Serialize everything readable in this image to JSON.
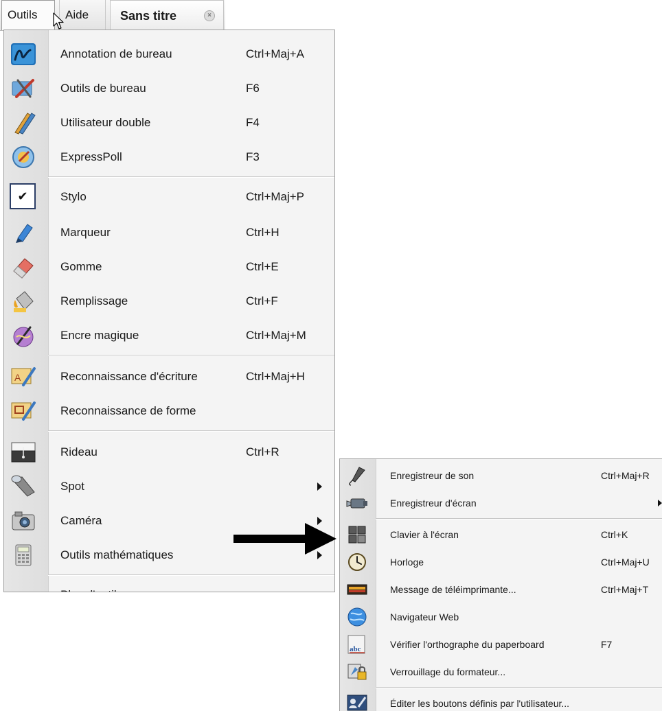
{
  "menubar": {
    "outils": "Outils",
    "aide": "Aide",
    "tab_title": "Sans titre"
  },
  "menu": {
    "items": [
      {
        "label": "Annotation de bureau",
        "shortcut": "Ctrl+Maj+A",
        "icon": "annotation-icon"
      },
      {
        "label": "Outils de bureau",
        "shortcut": "F6",
        "icon": "desktop-tools-icon"
      },
      {
        "label": "Utilisateur double",
        "shortcut": "F4",
        "icon": "dual-user-icon"
      },
      {
        "label": "ExpressPoll",
        "shortcut": "F3",
        "icon": "expresspoll-icon"
      },
      {
        "label": "Stylo",
        "shortcut": "Ctrl+Maj+P",
        "icon": "check-icon",
        "checked": true
      },
      {
        "label": "Marqueur",
        "shortcut": "Ctrl+H",
        "icon": "marker-icon"
      },
      {
        "label": "Gomme",
        "shortcut": "Ctrl+E",
        "icon": "eraser-icon"
      },
      {
        "label": "Remplissage",
        "shortcut": "Ctrl+F",
        "icon": "fill-icon"
      },
      {
        "label": "Encre magique",
        "shortcut": "Ctrl+Maj+M",
        "icon": "magic-ink-icon"
      },
      {
        "label": "Reconnaissance d'écriture",
        "shortcut": "Ctrl+Maj+H",
        "icon": "handwriting-recognition-icon"
      },
      {
        "label": "Reconnaissance de forme",
        "shortcut": "",
        "icon": "shape-recognition-icon"
      },
      {
        "label": "Rideau",
        "shortcut": "Ctrl+R",
        "icon": "curtain-icon"
      },
      {
        "label": "Spot",
        "shortcut": "",
        "icon": "spotlight-icon",
        "submenu": true
      },
      {
        "label": "Caméra",
        "shortcut": "",
        "icon": "camera-icon",
        "submenu": true
      },
      {
        "label": "Outils mathématiques",
        "shortcut": "",
        "icon": "calculator-icon",
        "submenu": true
      },
      {
        "label": "Plus d'outils...",
        "shortcut": "",
        "icon": ""
      }
    ]
  },
  "submenu": {
    "items": [
      {
        "label": "Enregistreur de son",
        "shortcut": "Ctrl+Maj+R",
        "icon": "microphone-icon"
      },
      {
        "label": "Enregistreur d'écran",
        "shortcut": "",
        "icon": "video-camera-icon",
        "submenu": true
      },
      {
        "label": "Clavier à l'écran",
        "shortcut": "Ctrl+K",
        "icon": "keyboard-icon"
      },
      {
        "label": "Horloge",
        "shortcut": "Ctrl+Maj+U",
        "icon": "clock-icon"
      },
      {
        "label": "Message de téléimprimante...",
        "shortcut": "Ctrl+Maj+T",
        "icon": "ticker-icon"
      },
      {
        "label": "Navigateur Web",
        "shortcut": "",
        "icon": "globe-icon"
      },
      {
        "label": "Vérifier l'orthographe du paperboard",
        "shortcut": "F7",
        "icon": "spellcheck-icon"
      },
      {
        "label": "Verrouillage du formateur...",
        "shortcut": "",
        "icon": "lock-icon"
      },
      {
        "label": "Éditer les boutons définis par l'utilisateur...",
        "shortcut": "",
        "icon": "user-buttons-icon"
      }
    ]
  },
  "spellcheck_icon_text": "abc"
}
